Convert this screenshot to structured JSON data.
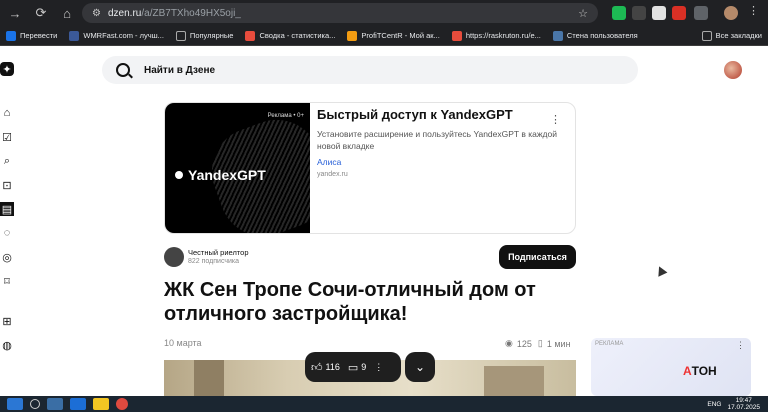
{
  "browser": {
    "url_host": "dzen.ru",
    "url_path": "/a/ZB7TXho49HX5oji_",
    "bookmarks": [
      {
        "label": "Перевести",
        "color": "#1a73e8"
      },
      {
        "label": "WMRFast.com - лучш...",
        "color": "#3b5998"
      },
      {
        "label": "Популярные",
        "color": "#8a8a8a"
      },
      {
        "label": "Сводка - статистика...",
        "color": "#e84c3d"
      },
      {
        "label": "ProfiTCentR - Мой ак...",
        "color": "#f39c12"
      },
      {
        "label": "https://raskruton.ru/e...",
        "color": "#e74c3c"
      },
      {
        "label": "Стена пользователя",
        "color": "#4a76a8"
      }
    ],
    "all_bookmarks_label": "Все закладки"
  },
  "search": {
    "placeholder": "Найти в Дзене"
  },
  "ad": {
    "badge": "Реклама • 0+",
    "logo_text": "YandexGPT",
    "title": "Быстрый доступ к YandexGPT",
    "description": "Установите расширение и пользуйтесь YandexGPT в каждой новой вкладке",
    "advertiser": "Алиса",
    "domain": "yandex.ru",
    "more": "⋮"
  },
  "author": {
    "name": "Честный риелтор",
    "subscribers": "822 подписчика",
    "subscribe_label": "Подписаться"
  },
  "article": {
    "title": "ЖК Сен Тропе Сочи-отличный дом от отличного застройщика!",
    "date": "10 марта",
    "views": "125",
    "read_time": "1 мин"
  },
  "reactions": {
    "likes": "116",
    "comments": "9",
    "more": "⋮",
    "down": "⌄"
  },
  "side_ad": {
    "label": "РЕКЛАМА",
    "brand_x": "A",
    "brand_rest": "ТОН",
    "more": "⋮"
  },
  "taskbar": {
    "lang": "ENG",
    "time": "19:47",
    "date": "17.07.2025"
  }
}
